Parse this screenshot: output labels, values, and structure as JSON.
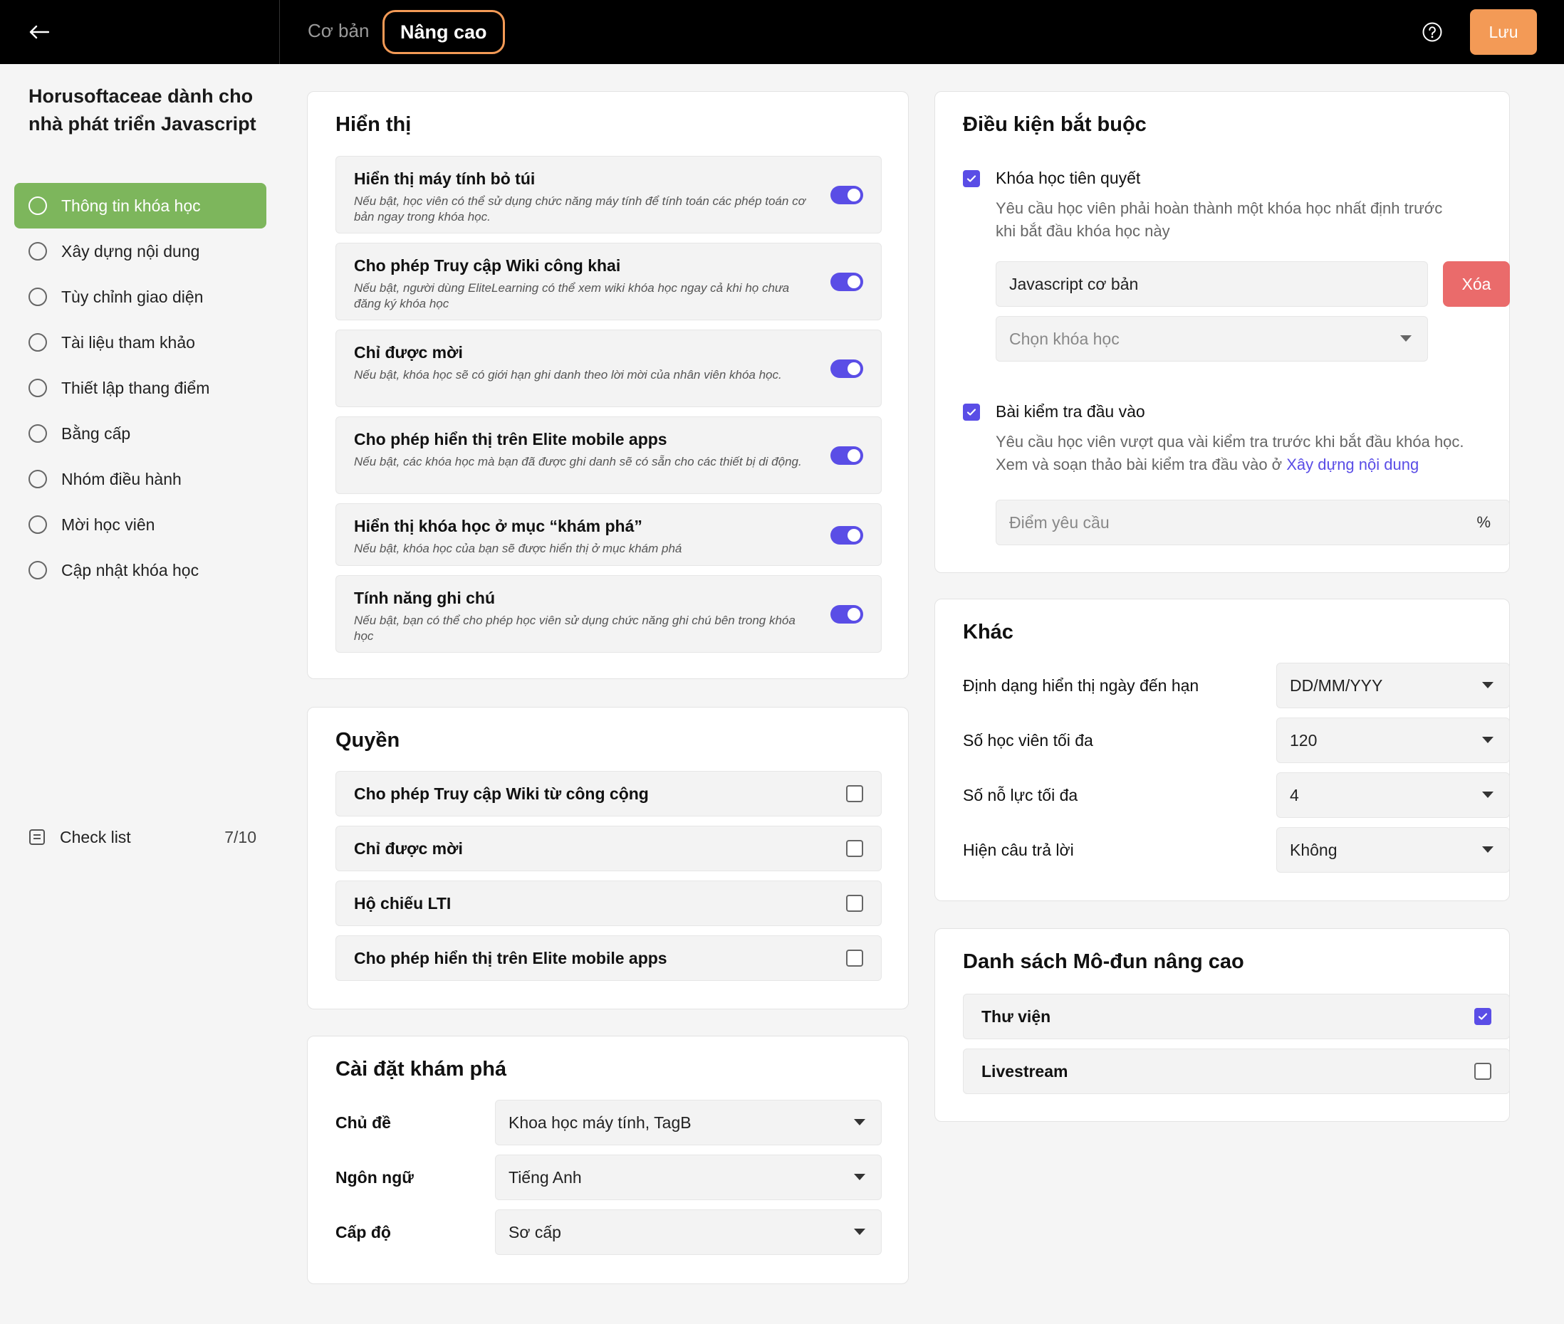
{
  "topbar": {
    "tab_basic": "Cơ bản",
    "tab_advanced": "Nâng cao",
    "save_label": "Lưu"
  },
  "sidebar": {
    "course_title": "Horusoftaceae dành cho nhà phát triển Javascript",
    "items": [
      {
        "label": "Thông tin khóa học"
      },
      {
        "label": "Xây dựng nội dung"
      },
      {
        "label": "Tùy chỉnh giao diện"
      },
      {
        "label": "Tài liệu tham khảo"
      },
      {
        "label": "Thiết lập thang điểm"
      },
      {
        "label": "Bằng cấp"
      },
      {
        "label": "Nhóm điều hành"
      },
      {
        "label": "Mời học viên"
      },
      {
        "label": "Cập nhật khóa học"
      }
    ],
    "checklist_label": "Check list",
    "checklist_count": "7/10"
  },
  "display": {
    "title": "Hiển thị",
    "options": [
      {
        "title": "Hiển thị máy tính bỏ túi",
        "desc": "Nếu bật, học viên có thể sử dụng chức năng máy tính để tính toán các phép toán cơ bản ngay trong khóa học."
      },
      {
        "title": "Cho phép Truy cập Wiki công khai",
        "desc": "Nếu bật, người dùng EliteLearning có thể xem wiki khóa học ngay cả khi họ chưa đăng ký khóa học"
      },
      {
        "title": "Chỉ được mời",
        "desc": "Nếu bật, khóa học sẽ có giới hạn ghi danh theo lời mời của nhân viên khóa học."
      },
      {
        "title": "Cho phép hiển thị trên Elite mobile apps",
        "desc": "Nếu bật, các khóa học mà bạn đã được ghi danh sẽ có sẵn cho các thiết bị di động."
      },
      {
        "title": "Hiển thị khóa học ở mục “khám phá”",
        "desc": "Nếu bật, khóa học của bạn sẽ được hiển thị ở mục khám phá"
      },
      {
        "title": "Tính năng ghi chú",
        "desc": "Nếu bật, bạn có thể cho phép học viên sử dụng chức năng ghi chú bên trong khóa học"
      }
    ]
  },
  "permissions": {
    "title": "Quyền",
    "options": [
      {
        "label": "Cho phép Truy cập Wiki từ công cộng"
      },
      {
        "label": "Chỉ được mời"
      },
      {
        "label": "Hộ chiếu LTI"
      },
      {
        "label": "Cho phép hiển thị trên Elite mobile apps"
      }
    ]
  },
  "discovery": {
    "title": "Cài đặt khám phá",
    "topic_label": "Chủ đề",
    "topic_value": "Khoa học máy tính, TagB",
    "language_label": "Ngôn ngữ",
    "language_value": "Tiếng Anh",
    "level_label": "Cấp độ",
    "level_value": "Sơ cấp"
  },
  "requirements": {
    "title": "Điều kiện bắt buộc",
    "prereq_label": "Khóa học tiên quyết",
    "prereq_desc_1": "Yêu cầu học viên phải hoàn thành một khóa học nhất định trước",
    "prereq_desc_2": "khi bắt đầu khóa học này",
    "prereq_course": "Javascript cơ bản",
    "delete_label": "Xóa",
    "select_course_placeholder": "Chọn khóa học",
    "entrance_label": "Bài kiểm tra đầu vào",
    "entrance_desc_1": "Yêu cầu học viên vượt qua vài kiểm tra trước khi bắt đầu khóa học.",
    "entrance_desc_2": "Xem và soạn thảo bài kiểm tra đầu vào ở ",
    "entrance_link": "Xây dựng nội dung",
    "score_placeholder": "Điểm yêu cầu",
    "score_unit": "%"
  },
  "other": {
    "title": "Khác",
    "rows": [
      {
        "label": "Định dạng hiển thị ngày đến hạn",
        "value": "DD/MM/YYY"
      },
      {
        "label": "Số học viên tối đa",
        "value": "120"
      },
      {
        "label": "Số nỗ lực tối đa",
        "value": "4"
      },
      {
        "label": "Hiện câu trả lời",
        "value": "Không"
      }
    ]
  },
  "modules": {
    "title": "Danh sách Mô-đun nâng cao",
    "items": [
      {
        "label": "Thư viện",
        "checked": true
      },
      {
        "label": "Livestream",
        "checked": false
      }
    ]
  },
  "colors": {
    "accent": "#5a4de6",
    "save": "#f39a56",
    "active_nav": "#7db65c",
    "delete": "#ea6b6b"
  }
}
